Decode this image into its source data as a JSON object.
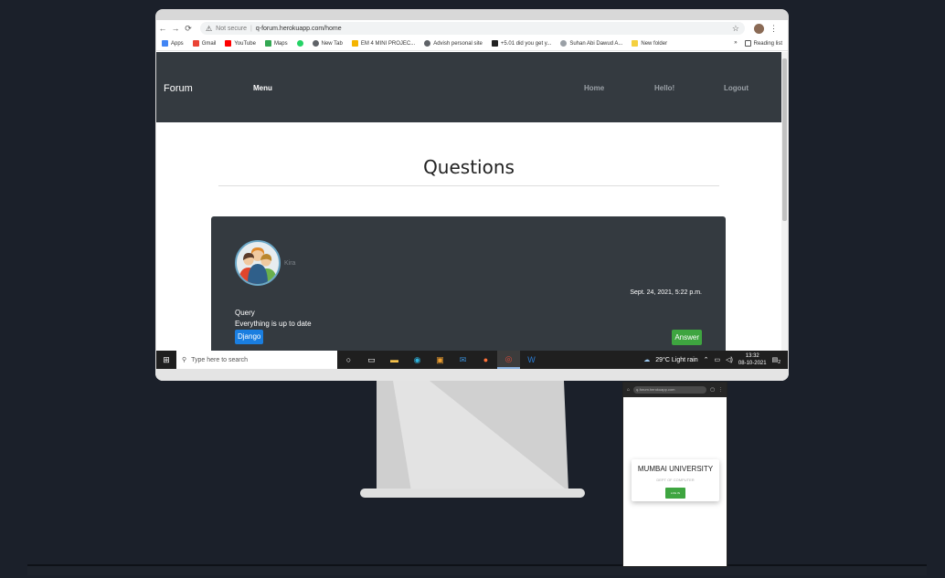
{
  "browser": {
    "not_secure": "Not secure",
    "url": "q-forum.herokuapp.com/home",
    "bookmarks": [
      {
        "label": "Apps",
        "color": "#4285f4"
      },
      {
        "label": "Gmail",
        "color": "#ea4335"
      },
      {
        "label": "YouTube",
        "color": "#ff0000"
      },
      {
        "label": "Maps",
        "color": "#34a853"
      },
      {
        "label": "",
        "color": "#25d366"
      },
      {
        "label": "New Tab",
        "color": "#5f6368"
      },
      {
        "label": "EM 4 MINI PROJEC...",
        "color": "#f4b400"
      },
      {
        "label": "Advish personal site",
        "color": "#5f6368"
      },
      {
        "label": "+5.01 did you get y...",
        "color": "#222222"
      },
      {
        "label": "Suhan Abi Dawud A...",
        "color": "#9aa0a6"
      },
      {
        "label": "New folder",
        "color": "#f4d03f"
      }
    ],
    "more": "»",
    "reading_list": "Reading list"
  },
  "site": {
    "brand": "Forum",
    "menu": "Menu",
    "nav": [
      "Home",
      "Hello!",
      "Logout"
    ],
    "heading": "Questions"
  },
  "question": {
    "user": "Kira",
    "date": "Sept. 24, 2021, 5:22 p.m.",
    "title": "Query",
    "body": "Everything is up to date",
    "tag": "Django",
    "answer": "Answer"
  },
  "taskbar": {
    "search_placeholder": "Type here to search",
    "weather": "29°C  Light rain",
    "time": "13:32",
    "date": "08-10-2021",
    "notif": "2"
  },
  "phone": {
    "url": "q-forum.herokuapp.com",
    "title": "MUMBAI UNIVERSITY",
    "subtitle": "DEPT OF COMPUTER",
    "button": "LOG IN"
  },
  "colors": {
    "navbar": "#343a40",
    "tag": "#1a7ee0",
    "answer": "#3ea540"
  }
}
